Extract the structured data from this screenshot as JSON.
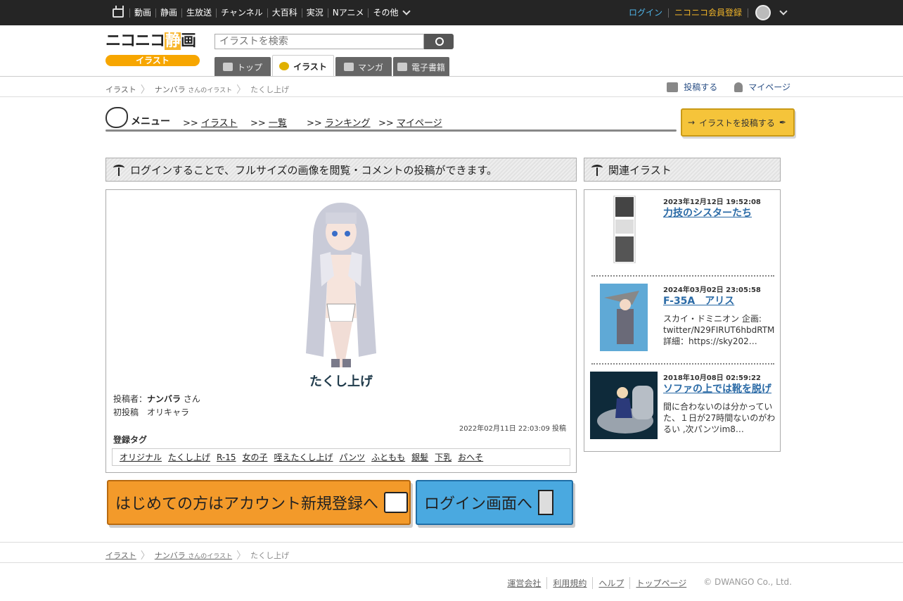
{
  "topbar": {
    "items": [
      "動画",
      "静画",
      "生放送",
      "チャンネル",
      "大百科",
      "実況",
      "Nアニメ",
      "その他"
    ],
    "login": "ログイン",
    "register": "ニコニコ会員登録"
  },
  "logo": {
    "main_a": "ニコニコ",
    "main_b": "静",
    "main_c": "画",
    "sub": "イラスト"
  },
  "search": {
    "placeholder": "イラストを検索"
  },
  "tabs": [
    "トップ",
    "イラスト",
    "マンガ",
    "電子書籍"
  ],
  "breadcrumb": {
    "root": "イラスト",
    "user": "ナンバラ",
    "user_suffix": "さんのイラスト",
    "current": "たくし上げ"
  },
  "crumb_actions": {
    "post": "投稿する",
    "mypage": "マイページ"
  },
  "menu": {
    "title": "メニュー",
    "items": [
      "イラスト",
      "一覧",
      "ランキング",
      "マイページ"
    ],
    "prefix": ">>",
    "post_button": "イラストを投稿する"
  },
  "main": {
    "header": "ログインすることで、フルサイズの画像を閲覧・コメントの投稿ができます。",
    "title": "たくし上げ",
    "author_label": "投稿者：",
    "author": "ナンバラ",
    "author_suffix": "さん",
    "description": "初投稿　オリキャラ",
    "date": "2022年02月11日 22:03:09 投稿",
    "tags_label": "登録タグ",
    "tags": [
      "オリジナル",
      "たくし上げ",
      "R-15",
      "女の子",
      "咥えたくし上げ",
      "パンツ",
      "ふともも",
      "銀髪",
      "下乳",
      "おへそ"
    ]
  },
  "banners": {
    "register": "はじめての方はアカウント新規登録へ",
    "login": "ログイン画面へ"
  },
  "related": {
    "header": "関連イラスト",
    "items": [
      {
        "date": "2023年12月12日 19:52:08",
        "title": "力技のシスターたち",
        "desc": ""
      },
      {
        "date": "2024年03月02日 23:05:58",
        "title": "F-35A　アリス",
        "desc": "スカイ・ドミニオン 企画: twitter/N29FIRUT6hbdRTM 詳細：https://sky202…"
      },
      {
        "date": "2018年10月08日 02:59:22",
        "title": "ソファの上では靴を脱げ",
        "desc": "間に合わないのは分かっていた、１日が27時間ないのがわるい ,次パンツim8…"
      }
    ]
  },
  "footer": {
    "links": [
      "運営会社",
      "利用規約",
      "ヘルプ",
      "トップページ"
    ],
    "copyright": "© DWANGO Co., Ltd."
  },
  "colors": {
    "topbar": "#252525",
    "accent_orange": "#f7a600",
    "link_blue": "#2a6aa6"
  }
}
